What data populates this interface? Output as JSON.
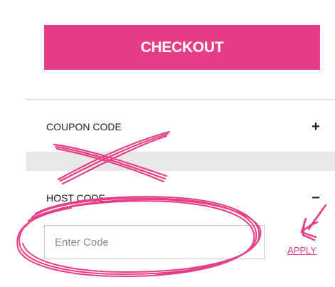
{
  "checkout": {
    "label": "CHECKOUT",
    "color": "#e53d86"
  },
  "coupon": {
    "label": "COUPON CODE",
    "toggle": "+",
    "toggle_icon": "plus-icon"
  },
  "host": {
    "label": "HOST CODE",
    "toggle": "−",
    "toggle_icon": "minus-icon",
    "input_placeholder": "Enter Code",
    "input_value": "",
    "apply_label": "APPLY"
  },
  "annotations": {
    "color": "#e53d86",
    "marks": [
      "cross-mark",
      "circle-mark",
      "arrow-mark"
    ]
  }
}
